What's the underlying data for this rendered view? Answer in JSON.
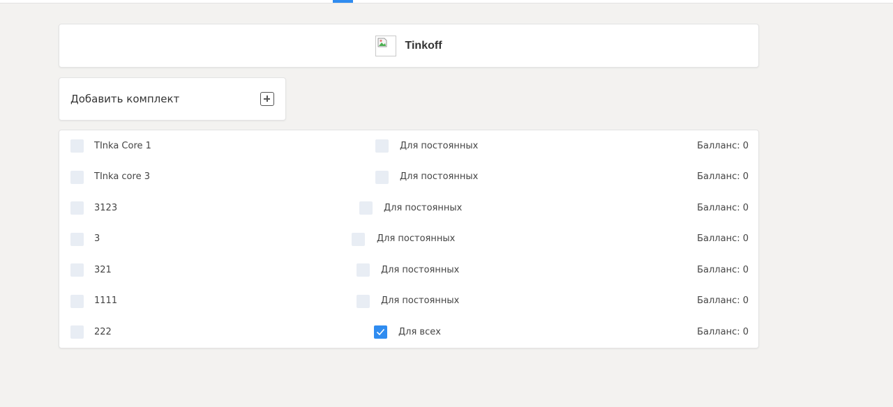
{
  "bank": {
    "name": "Tinkoff",
    "logo_icon": "broken-image-icon"
  },
  "add_set": {
    "label": "Добавить комплект",
    "icon": "plus-square-icon"
  },
  "sets": [
    {
      "name": "TInka Core 1",
      "type": "Для постоянных",
      "balance": "Балланс: 0",
      "checked": false
    },
    {
      "name": "TInka core 3",
      "type": "Для постоянных",
      "balance": "Балланс: 0",
      "checked": false
    },
    {
      "name": "3123",
      "type": "Для постоянных",
      "balance": "Балланс: 0",
      "checked": false
    },
    {
      "name": "3",
      "type": "Для постоянных",
      "balance": "Балланс: 0",
      "checked": false
    },
    {
      "name": "321",
      "type": "Для постоянных",
      "balance": "Балланс: 0",
      "checked": false
    },
    {
      "name": "1111",
      "type": "Для постоянных",
      "balance": "Балланс: 0",
      "checked": false
    },
    {
      "name": "222",
      "type": "Для всех",
      "balance": "Балланс: 0",
      "checked": true
    }
  ],
  "colors": {
    "accent": "#2f8cf0",
    "background": "#f3f2f0",
    "checkbox_unchecked": "#e8edf4"
  }
}
